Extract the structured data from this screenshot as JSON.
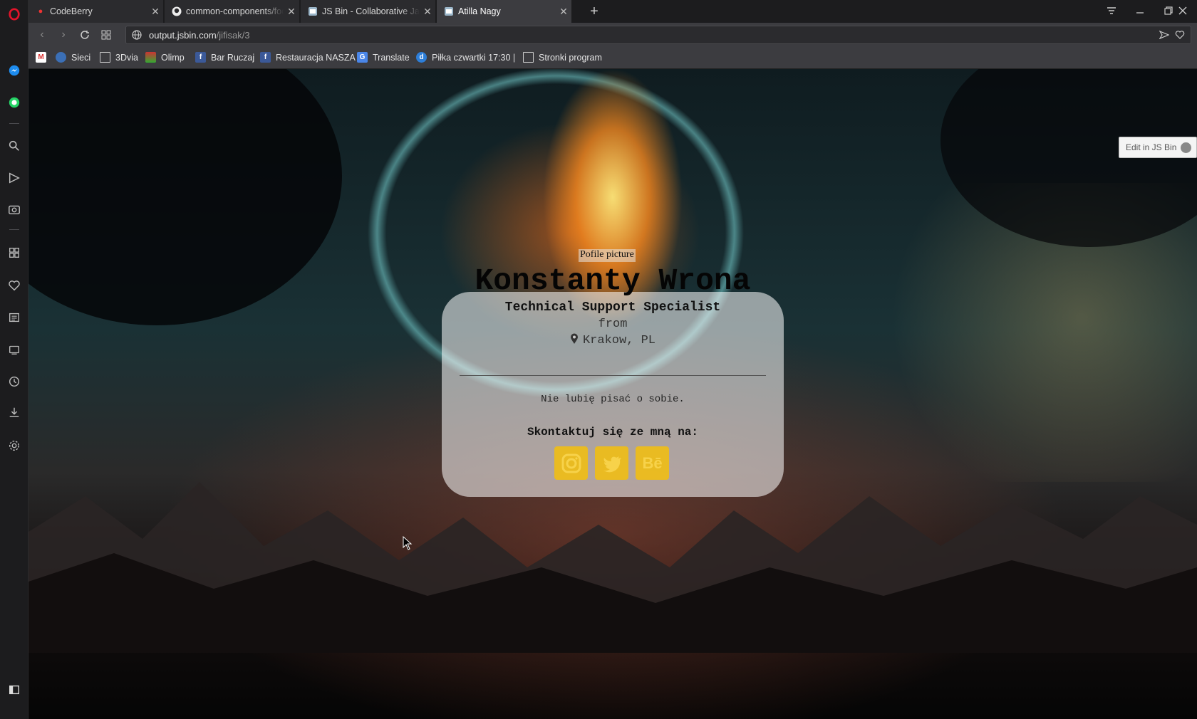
{
  "browser": {
    "tabs": [
      {
        "title": "CodeBerry",
        "active": false
      },
      {
        "title": "common-components/foo",
        "active": false
      },
      {
        "title": "JS Bin - Collaborative JavaS",
        "active": false
      },
      {
        "title": "Atilla Nagy",
        "active": true
      }
    ],
    "url_domain": "output.jsbin.com",
    "url_path": "/jifisak/3",
    "bookmarks": [
      "Sieci",
      "3Dvia",
      "Olimp",
      "Bar Ruczaj",
      "Restauracja NASZA",
      "Translate",
      "Piłka czwartki 17:30 |",
      "Stronki program"
    ]
  },
  "page": {
    "edit_label": "Edit in JS Bin",
    "profile_pic_alt": "Pofile picture",
    "name": "Konstanty Wrona",
    "role": "Technical Support Specialist",
    "from": "from",
    "location": "Krakow, PL",
    "about": "Nie lubię pisać o sobie.",
    "contact": "Skontaktuj się ze mną na:",
    "socials": [
      "instagram-icon",
      "twitter-icon",
      "behance-icon"
    ],
    "behance_text": "Bē",
    "accent": "#f0be14"
  }
}
